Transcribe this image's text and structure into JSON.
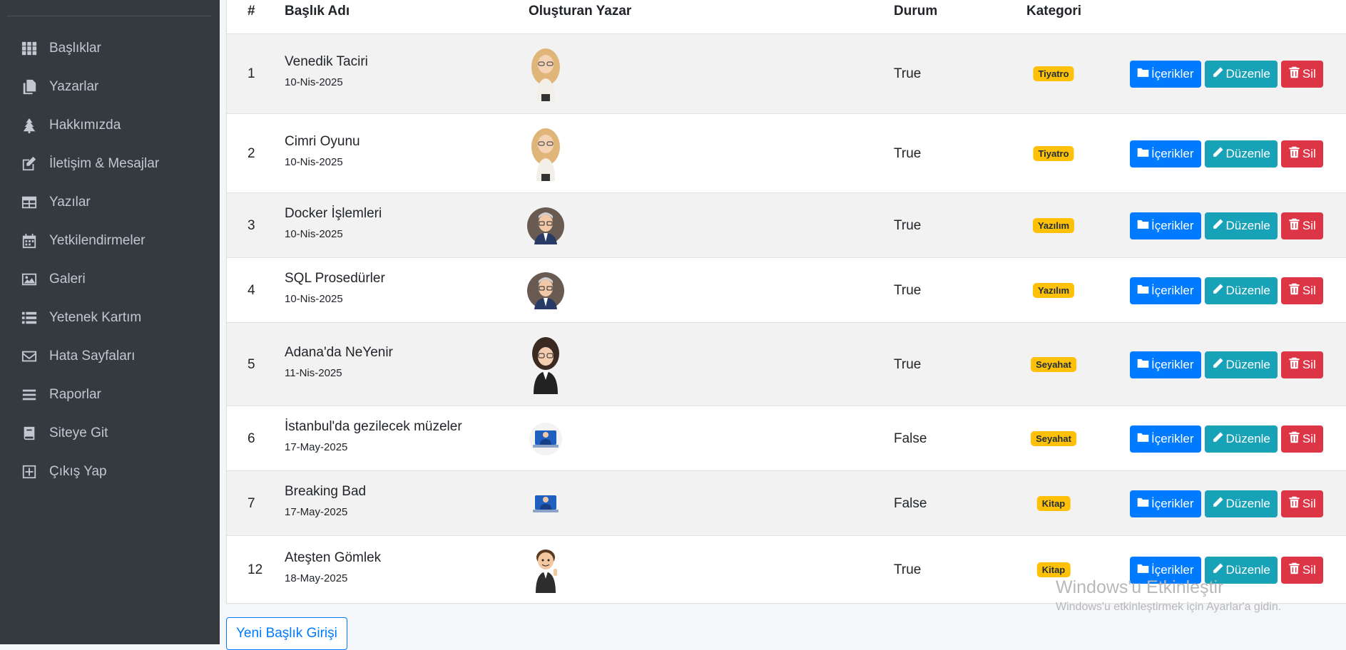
{
  "sidebar": {
    "items": [
      {
        "label": "Başlıklar",
        "icon": "grid-icon"
      },
      {
        "label": "Yazarlar",
        "icon": "copy-icon"
      },
      {
        "label": "Hakkımızda",
        "icon": "tree-icon"
      },
      {
        "label": "İletişim & Mesajlar",
        "icon": "edit-icon"
      },
      {
        "label": "Yazılar",
        "icon": "table-icon"
      },
      {
        "label": "Yetkilendirmeler",
        "icon": "calendar-icon"
      },
      {
        "label": "Galeri",
        "icon": "image-icon"
      },
      {
        "label": "Yetenek Kartım",
        "icon": "list-icon"
      },
      {
        "label": "Hata Sayfaları",
        "icon": "envelope-icon"
      },
      {
        "label": "Raporlar",
        "icon": "bars-icon"
      },
      {
        "label": "Siteye Git",
        "icon": "book-icon"
      },
      {
        "label": "Çıkış Yap",
        "icon": "plus-square-icon"
      }
    ]
  },
  "table": {
    "headers": {
      "num": "#",
      "title": "Başlık Adı",
      "author": "Oluşturan Yazar",
      "status": "Durum",
      "category": "Kategori"
    },
    "rows": [
      {
        "num": "1",
        "title": "Venedik Taciri",
        "date": "10-Nis-2025",
        "status": "True",
        "category": "Tiyatro",
        "avatar": "woman-blonde"
      },
      {
        "num": "2",
        "title": "Cimri Oyunu",
        "date": "10-Nis-2025",
        "status": "True",
        "category": "Tiyatro",
        "avatar": "woman-blonde"
      },
      {
        "num": "3",
        "title": "Docker İşlemleri",
        "date": "10-Nis-2025",
        "status": "True",
        "category": "Yazılım",
        "avatar": "man-glasses"
      },
      {
        "num": "4",
        "title": "SQL Prosedürler",
        "date": "10-Nis-2025",
        "status": "True",
        "category": "Yazılım",
        "avatar": "man-glasses"
      },
      {
        "num": "5",
        "title": "Adana'da NeYenir",
        "date": "11-Nis-2025",
        "status": "True",
        "category": "Seyahat",
        "avatar": "woman-dark"
      },
      {
        "num": "6",
        "title": "İstanbul'da gezilecek müzeler",
        "date": "17-May-2025",
        "status": "False",
        "category": "Seyahat",
        "avatar": "computer-user"
      },
      {
        "num": "7",
        "title": "Breaking Bad",
        "date": "17-May-2025",
        "status": "False",
        "category": "Kitap",
        "avatar": "computer-user"
      },
      {
        "num": "12",
        "title": "Ateşten Gömlek",
        "date": "18-May-2025",
        "status": "True",
        "category": "Kitap",
        "avatar": "cartoon-man"
      }
    ],
    "actions": {
      "contents": "İçerikler",
      "edit": "Düzenle",
      "delete": "Sil"
    }
  },
  "new_button_label": "Yeni Başlık Girişi",
  "watermark": {
    "line1": "Windows'u Etkinleştir",
    "line2": "Windows'u etkinleştirmek için Ayarlar'a gidin."
  },
  "colors": {
    "sidebar_bg": "#343a40",
    "primary": "#007bff",
    "info": "#17a2b8",
    "danger": "#dc3545",
    "badge": "#ffc107"
  }
}
